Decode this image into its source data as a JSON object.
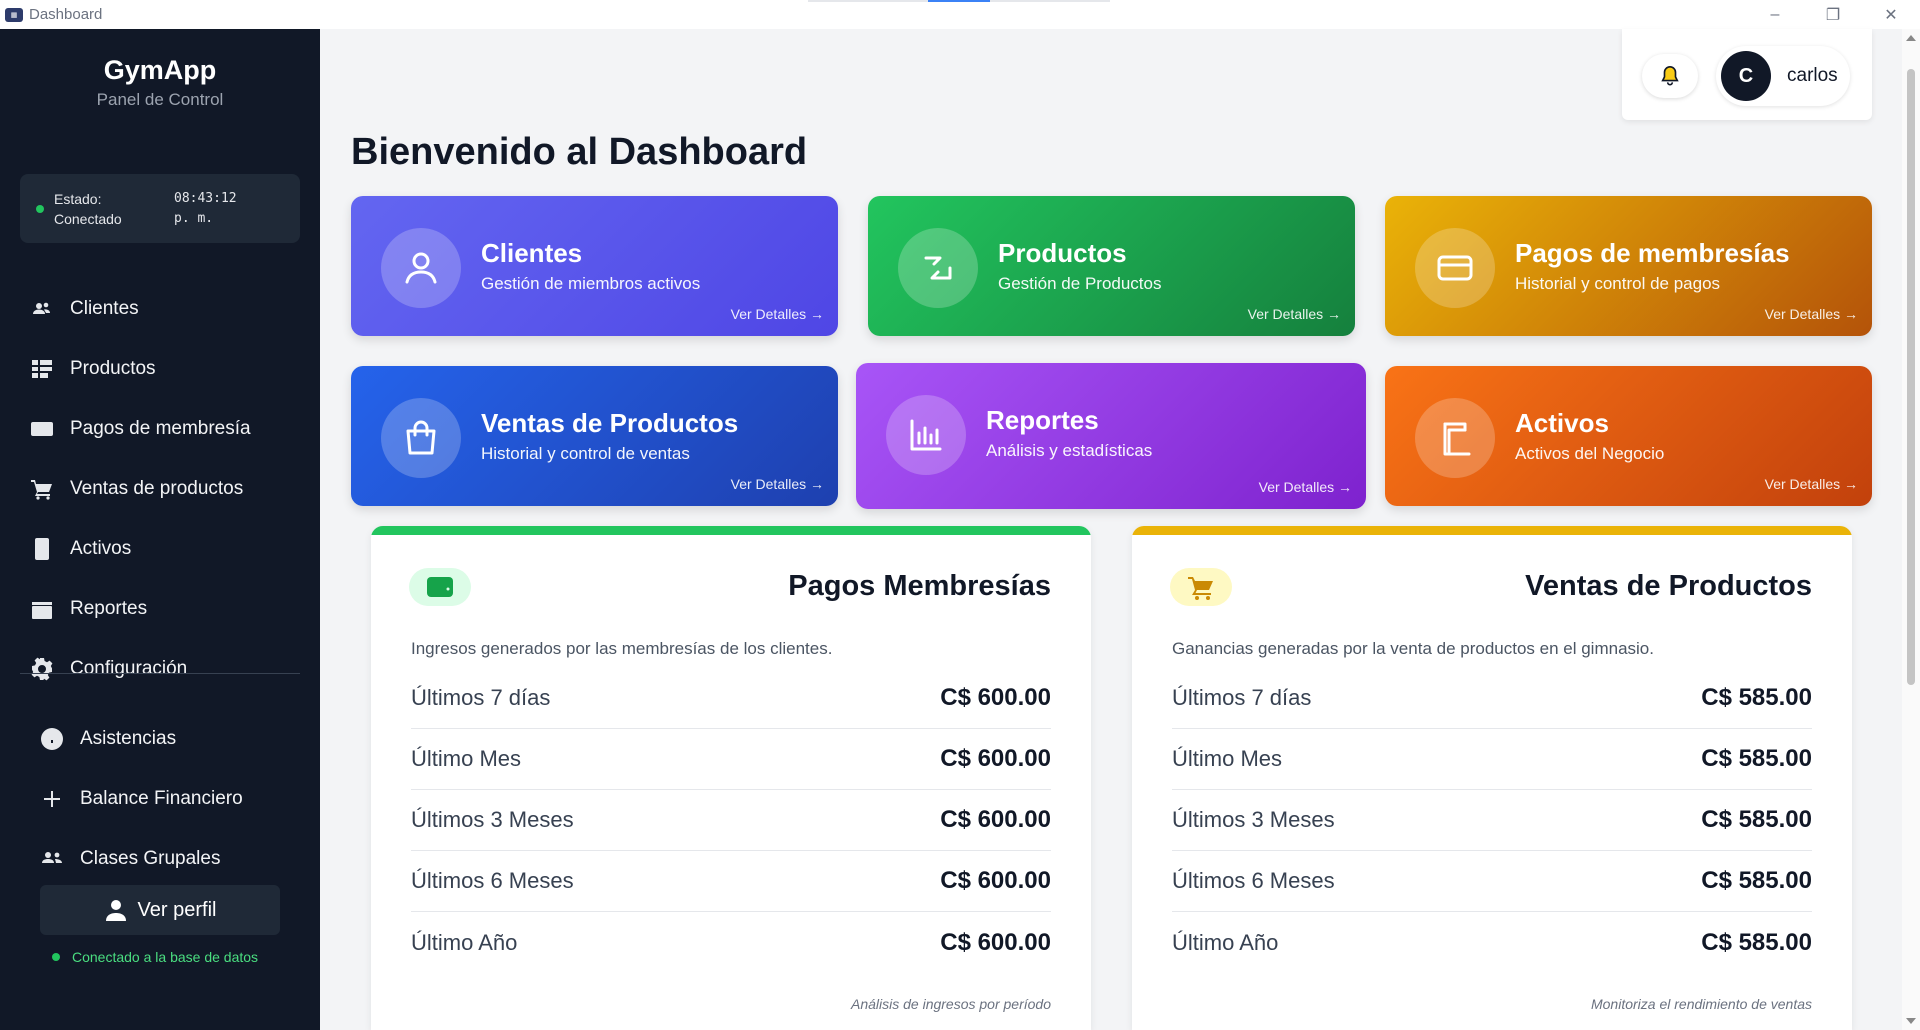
{
  "window": {
    "title": "Dashboard",
    "controls": [
      "–",
      "❐",
      "✕"
    ]
  },
  "sidebar": {
    "brand": "GymApp",
    "subtitle": "Panel de Control",
    "status": {
      "label": "Estado:\nConectado",
      "time": "08:43:12\np. m."
    },
    "items": [
      {
        "label": "Clientes",
        "icon": "users-icon"
      },
      {
        "label": "Productos",
        "icon": "list-icon"
      },
      {
        "label": "Pagos de membresía",
        "icon": "card-icon"
      },
      {
        "label": "Ventas de productos",
        "icon": "cart-icon"
      },
      {
        "label": "Activos",
        "icon": "box-icon"
      },
      {
        "label": "Reportes",
        "icon": "folder-icon"
      },
      {
        "label": "Configuración",
        "icon": "gear-icon"
      }
    ],
    "items2": [
      {
        "label": "Asistencias",
        "icon": "clock-icon"
      },
      {
        "label": "Balance Financiero",
        "icon": "plus-icon"
      },
      {
        "label": "Clases Grupales",
        "icon": "group-icon"
      }
    ],
    "profile_label": "Ver perfil",
    "db_status": "Conectado a la base de datos"
  },
  "header": {
    "avatar_letter": "C",
    "username": "carlos"
  },
  "page_title": "Bienvenido al Dashboard",
  "cards": [
    {
      "title": "Clientes",
      "subtitle": "Gestión de miembros activos",
      "link": "Ver Detalles →"
    },
    {
      "title": "Productos",
      "subtitle": "Gestión de Productos",
      "link": "Ver Detalles →"
    },
    {
      "title": "Pagos de membresías",
      "subtitle": "Historial y control de pagos",
      "link": "Ver Detalles →"
    },
    {
      "title": "Ventas de Productos",
      "subtitle": "Historial y control de ventas",
      "link": "Ver Detalles →"
    },
    {
      "title": "Reportes",
      "subtitle": "Análisis y estadísticas",
      "link": "Ver Detalles →"
    },
    {
      "title": "Activos",
      "subtitle": "Activos del Negocio",
      "link": "Ver Detalles →"
    }
  ],
  "panels": {
    "memberships": {
      "title": "Pagos Membresías",
      "description": "Ingresos generados por las membresías de los clientes.",
      "rows": [
        {
          "label": "Últimos 7 días",
          "value": "C$ 600.00"
        },
        {
          "label": "Último Mes",
          "value": "C$ 600.00"
        },
        {
          "label": "Últimos 3 Meses",
          "value": "C$ 600.00"
        },
        {
          "label": "Últimos 6 Meses",
          "value": "C$ 600.00"
        },
        {
          "label": "Último Año",
          "value": "C$ 600.00"
        }
      ],
      "note": "Análisis de ingresos por período"
    },
    "sales": {
      "title": "Ventas de Productos",
      "description": "Ganancias generadas por la venta de productos en el gimnasio.",
      "rows": [
        {
          "label": "Últimos 7 días",
          "value": "C$ 585.00"
        },
        {
          "label": "Último Mes",
          "value": "C$ 585.00"
        },
        {
          "label": "Últimos 3 Meses",
          "value": "C$ 585.00"
        },
        {
          "label": "Últimos 6 Meses",
          "value": "C$ 585.00"
        },
        {
          "label": "Último Año",
          "value": "C$ 585.00"
        }
      ],
      "note": "Monitoriza el rendimiento de ventas"
    }
  },
  "colors": {
    "sidebar_bg": "#111827",
    "clientes": "#5b50e6",
    "productos": "#16a34a",
    "pagos": "#d39a07",
    "ventas": "#2251d6",
    "reportes": "#9333ea",
    "activos": "#ea580c"
  }
}
